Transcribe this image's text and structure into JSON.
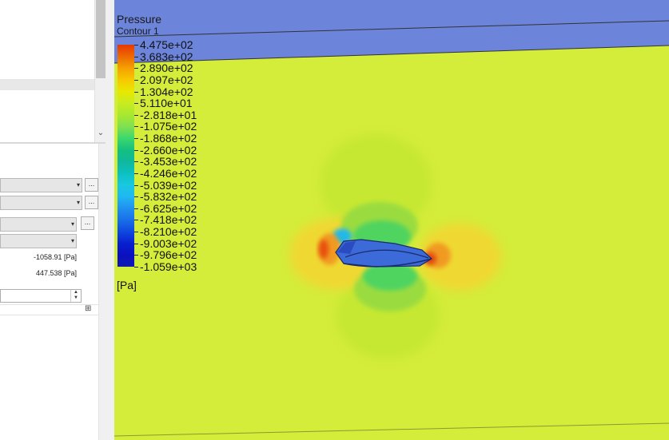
{
  "legend": {
    "title": "Pressure",
    "subtitle": "Contour 1",
    "unit": "[Pa]",
    "labels": [
      "4.475e+02",
      "3.683e+02",
      "2.890e+02",
      "2.097e+02",
      "1.304e+02",
      "5.110e+01",
      "-2.818e+01",
      "-1.075e+02",
      "-1.868e+02",
      "-2.660e+02",
      "-3.453e+02",
      "-4.246e+02",
      "-5.039e+02",
      "-5.832e+02",
      "-6.625e+02",
      "-7.418e+02",
      "-8.210e+02",
      "-9.003e+02",
      "-9.796e+02",
      "-1.059e+03"
    ],
    "colors": [
      "#e63800",
      "#ee6a00",
      "#f5a000",
      "#f8c800",
      "#e8e800",
      "#c8ec20",
      "#a8e830",
      "#80e050",
      "#3cd86c",
      "#14c080",
      "#10b89c",
      "#0cc0c0",
      "#18c8e0",
      "#20b8f0",
      "#2090f0",
      "#1870e8",
      "#1048e0",
      "#0820d0",
      "#0a10c0",
      "#1018b0"
    ]
  },
  "properties": {
    "min_value": "-1058.91 [Pa]",
    "max_value": "447.538 [Pa]",
    "dots_label": "..."
  },
  "icons": {
    "combo_arrow": "▾",
    "scroll_down": "⌄",
    "spin_up": "▲",
    "spin_down": "▼",
    "expand": "⊞"
  },
  "scene": {
    "background": "#d4ec3a",
    "far_field": "#6c84da"
  }
}
